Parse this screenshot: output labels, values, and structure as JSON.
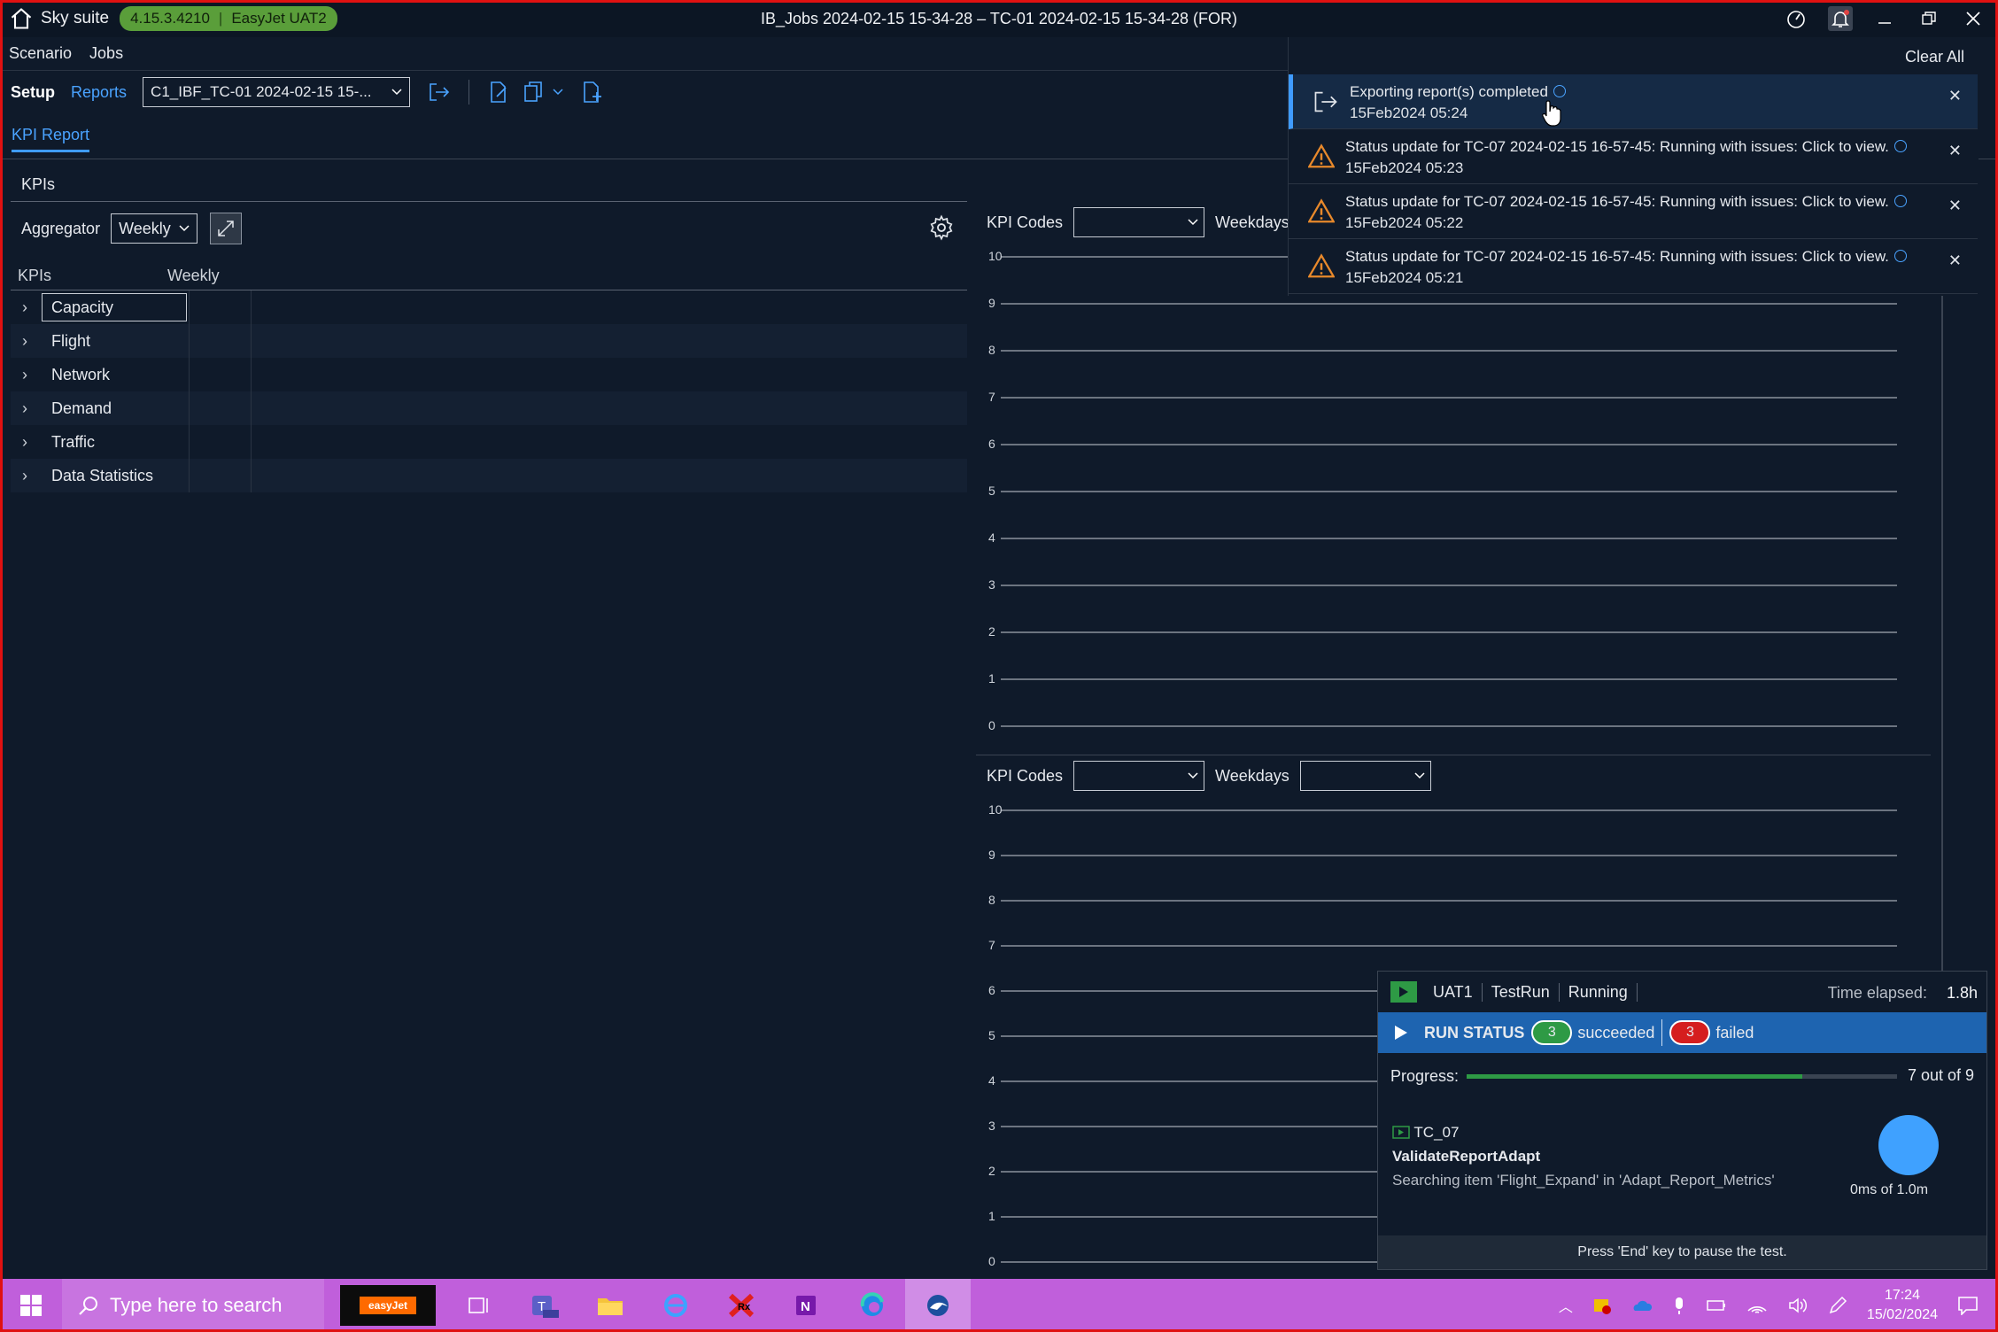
{
  "titlebar": {
    "app_name": "Sky suite",
    "version": "4.15.3.4210",
    "environment": "EasyJet UAT2",
    "window_title": "IB_Jobs 2024-02-15 15-34-28 – TC-01 2024-02-15 15-34-28 (FOR)"
  },
  "menu": {
    "scenario": "Scenario",
    "jobs": "Jobs"
  },
  "toolbar": {
    "setup_tab": "Setup",
    "reports_tab": "Reports",
    "scenario_select": "C1_IBF_TC-01 2024-02-15 15-..."
  },
  "subtab": {
    "kpi_report": "KPI Report"
  },
  "kpis": {
    "heading": "KPIs",
    "aggregator_label": "Aggregator",
    "aggregator_value": "Weekly",
    "col_kpis": "KPIs",
    "col_weekly": "Weekly",
    "items": [
      "Capacity",
      "Flight",
      "Network",
      "Demand",
      "Traffic",
      "Data Statistics"
    ]
  },
  "chart_top": {
    "kpi_codes_label": "KPI Codes",
    "weekdays_label": "Weekdays"
  },
  "chart_bottom": {
    "kpi_codes_label": "KPI Codes",
    "weekdays_label": "Weekdays"
  },
  "chart_data": [
    {
      "type": "line",
      "title": "",
      "xlabel": "",
      "ylabel": "",
      "ylim": [
        0,
        10
      ],
      "y_ticks": [
        "10",
        "9",
        "8",
        "7",
        "6",
        "5",
        "4",
        "3",
        "2",
        "1",
        "0"
      ],
      "series": [],
      "grid": true
    },
    {
      "type": "line",
      "title": "",
      "xlabel": "",
      "ylabel": "",
      "ylim": [
        0,
        10
      ],
      "y_ticks": [
        "10",
        "9",
        "8",
        "7",
        "6",
        "5",
        "4",
        "3",
        "2",
        "1",
        "0"
      ],
      "series": [],
      "grid": true
    }
  ],
  "notifications": {
    "clear_all": "Clear All",
    "items": [
      {
        "text": "Exporting report(s) completed",
        "time": "15Feb2024 05:24"
      },
      {
        "text": "Status update for TC-07 2024-02-15 16-57-45: Running with issues: Click to view.",
        "time": "15Feb2024 05:23"
      },
      {
        "text": "Status update for TC-07 2024-02-15 16-57-45: Running with issues: Click to view.",
        "time": "15Feb2024 05:22"
      },
      {
        "text": "Status update for TC-07 2024-02-15 16-57-45: Running with issues: Click to view.",
        "time": "15Feb2024 05:21"
      }
    ]
  },
  "run": {
    "env": "UAT1",
    "kind": "TestRun",
    "state": "Running",
    "elapsed_label": "Time elapsed:",
    "elapsed_value": "1.8h",
    "status_label": "RUN STATUS",
    "succeeded_count": "3",
    "succeeded_label": "succeeded",
    "failed_count": "3",
    "failed_label": "failed",
    "progress_label": "Progress:",
    "progress_text": "7 out of 9",
    "progress_fraction": 0.78,
    "test_case": "TC_07",
    "step": "ValidateReportAdapt",
    "detail": "Searching item 'Flight_Expand' in 'Adapt_Report_Metrics'",
    "timer": "0ms of 1.0m",
    "footer": "Press 'End' key to pause the test."
  },
  "taskbar": {
    "search_placeholder": "Type here to search",
    "easyjet_label": "easyJet",
    "time": "17:24",
    "date": "15/02/2024"
  },
  "colors": {
    "background": "#0f1a2a",
    "accent": "#3f9bff",
    "success": "#2e9a45",
    "danger": "#d51e1e",
    "taskbar": "#c05fdb"
  }
}
